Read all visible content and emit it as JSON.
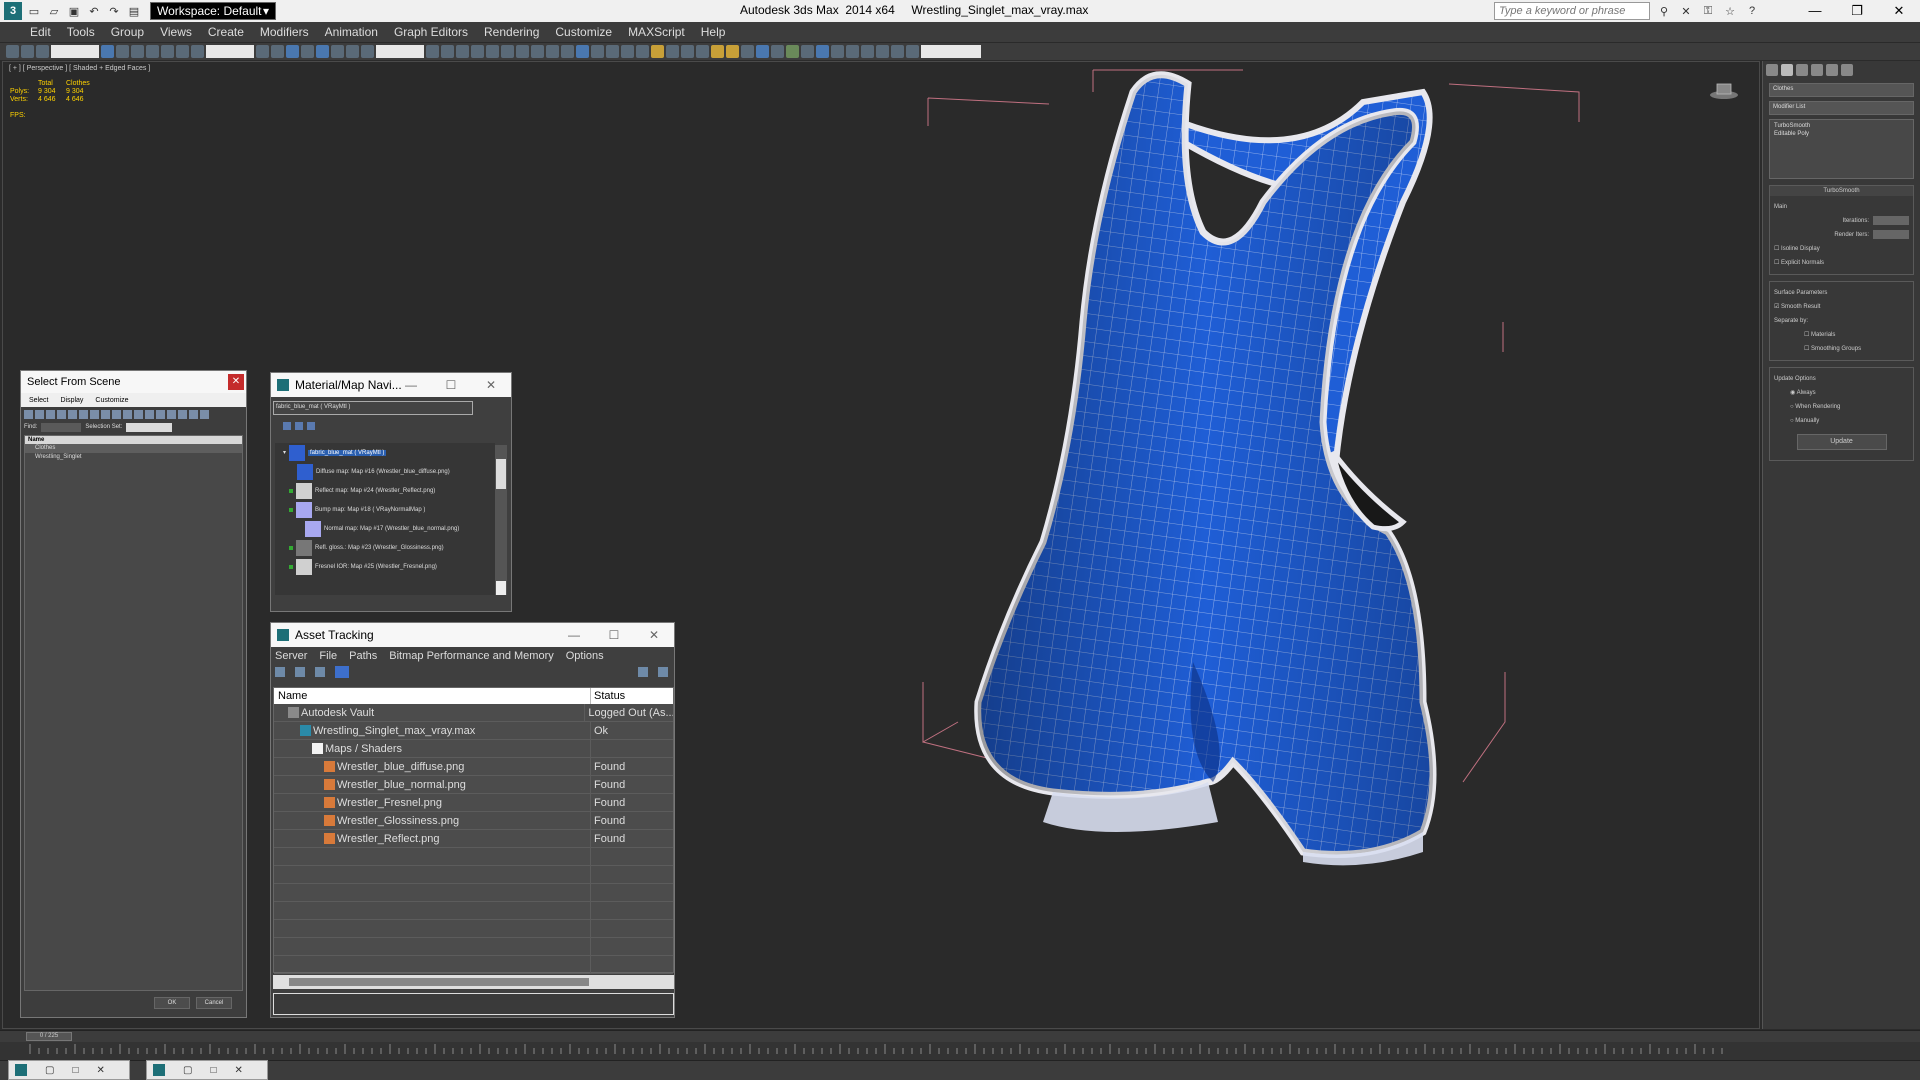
{
  "titlebar": {
    "workspace": "Workspace: Default",
    "app_title": "Autodesk 3ds Max  2014 x64     Wrestling_Singlet_max_vray.max",
    "search_placeholder": "Type a keyword or phrase"
  },
  "menu": [
    "Edit",
    "Tools",
    "Group",
    "Views",
    "Create",
    "Modifiers",
    "Animation",
    "Graph Editors",
    "Rendering",
    "Customize",
    "MAXScript",
    "Help"
  ],
  "viewport": {
    "label": "[ + ] [ Perspective ] [ Shaded + Edged Faces ]",
    "stats": {
      "header": [
        "Total",
        "Clothes"
      ],
      "polys": [
        "Polys:",
        "9 304",
        "9 304"
      ],
      "verts": [
        "Verts:",
        "4 646",
        "4 646"
      ],
      "fps": "FPS:"
    }
  },
  "command_panel": {
    "object_name": "Clothes",
    "modifier_list": "Modifier List",
    "stack": [
      "TurboSmooth",
      "Editable Poly"
    ],
    "turbosmooth": {
      "title": "TurboSmooth",
      "main": "Main",
      "iterations": "Iterations:",
      "render_iters": "Render Iters:",
      "isoline": "Isoline Display",
      "explicit": "Explicit Normals"
    },
    "surface": {
      "title": "Surface Parameters",
      "smooth_result": "Smooth Result",
      "separate_by": "Separate by:",
      "materials": "Materials",
      "smoothing_groups": "Smoothing Groups"
    },
    "update": {
      "title": "Update Options",
      "always": "Always",
      "when_rendering": "When Rendering",
      "manually": "Manually",
      "button": "Update"
    }
  },
  "select_from_scene": {
    "title": "Select From Scene",
    "menu": [
      "Select",
      "Display",
      "Customize"
    ],
    "find_label": "Find:",
    "selection_set": "Selection Set:",
    "column": "Name",
    "items": [
      "Clothes",
      "Wrestling_Singlet"
    ],
    "ok": "OK",
    "cancel": "Cancel"
  },
  "material_navigator": {
    "title": "Material/Map Navi...",
    "material_field": "fabric_blue_mat  ( VRayMtl )",
    "root": "fabric_blue_mat  ( VRayMtl )",
    "nodes": [
      "Diffuse map: Map #16 (Wrestler_blue_diffuse.png)",
      "Reflect map: Map #24 (Wrestler_Reflect.png)",
      "Bump map: Map #18  ( VRayNormalMap )",
      "Normal map: Map #17 (Wrestler_blue_normal.png)",
      "Refl. gloss.: Map #23 (Wrestler_Glossiness.png)",
      "Fresnel IOR: Map #25 (Wrestler_Fresnel.png)"
    ]
  },
  "asset_tracking": {
    "title": "Asset Tracking",
    "menu": [
      "Server",
      "File",
      "Paths",
      "Bitmap Performance and Memory",
      "Options"
    ],
    "columns": [
      "Name",
      "Status"
    ],
    "rows": [
      {
        "name": "Autodesk Vault",
        "status": "Logged Out (As...",
        "icon": "vault-icon"
      },
      {
        "name": "Wrestling_Singlet_max_vray.max",
        "status": "Ok",
        "icon": "max-file-icon"
      },
      {
        "name": "Maps / Shaders",
        "status": "",
        "icon": "folder-icon"
      },
      {
        "name": "Wrestler_blue_diffuse.png",
        "status": "Found",
        "icon": "image-file-icon"
      },
      {
        "name": "Wrestler_blue_normal.png",
        "status": "Found",
        "icon": "image-file-icon"
      },
      {
        "name": "Wrestler_Fresnel.png",
        "status": "Found",
        "icon": "image-file-icon"
      },
      {
        "name": "Wrestler_Glossiness.png",
        "status": "Found",
        "icon": "image-file-icon"
      },
      {
        "name": "Wrestler_Reflect.png",
        "status": "Found",
        "icon": "image-file-icon"
      }
    ]
  },
  "timeline": {
    "slider": "0 / 225"
  },
  "colors": {
    "singlet_blue": "#1f5ed6",
    "trim_white": "#e8e8ee",
    "bbox_pink": "#c07080",
    "stats_yellow": "#ffd200"
  }
}
